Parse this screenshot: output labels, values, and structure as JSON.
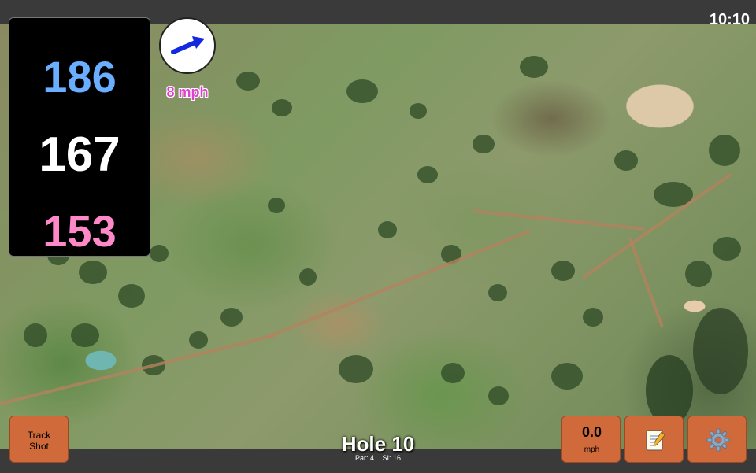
{
  "status_bar": {
    "time": "10:10"
  },
  "distances": {
    "back": "186",
    "center": "167",
    "front": "153"
  },
  "wind": {
    "speed": "8 mph",
    "icon": "wind-arrow-icon"
  },
  "buttons": {
    "track_shot": "Track\nShot",
    "speed_value": "0.0",
    "speed_unit": "mph",
    "notes_icon": "notepad-icon",
    "settings_icon": "gear-icon"
  },
  "hole": {
    "title": "Hole 10",
    "par": "Par: 4",
    "si": "SI: 16"
  },
  "colors": {
    "distance_back": "#6aaeff",
    "distance_center": "#ffffff",
    "distance_front": "#ff88c8",
    "wind_speed": "#e040d0",
    "button": "#d16a3a"
  }
}
